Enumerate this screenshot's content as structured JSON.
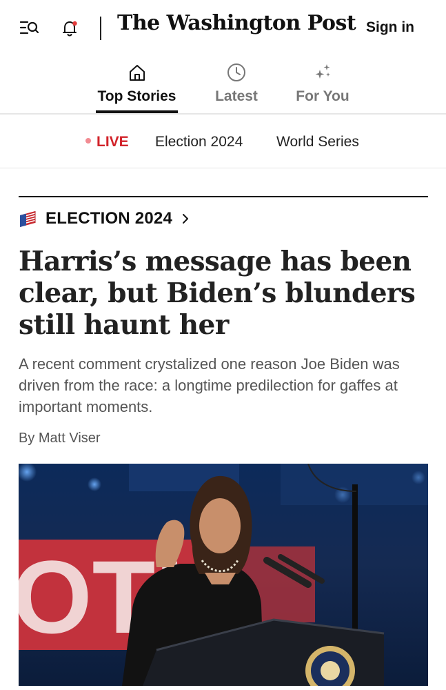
{
  "header": {
    "masthead": "The Washington Post",
    "sign_in_label": "Sign in",
    "icons": [
      "menu-search-icon",
      "bell-icon"
    ]
  },
  "tabs": [
    {
      "label": "Top Stories",
      "icon": "home-icon",
      "active": true
    },
    {
      "label": "Latest",
      "icon": "clock-icon",
      "active": false
    },
    {
      "label": "For You",
      "icon": "sparkle-icon",
      "active": false
    }
  ],
  "topics": {
    "live_label": "LIVE",
    "items": [
      "Election 2024",
      "World Series"
    ]
  },
  "article": {
    "kicker": "ELECTION 2024",
    "headline": "Harris’s message has been clear, but Biden’s blunders still haunt her",
    "dek": "A recent comment crystalized one reason Joe Biden was driven from the race: a longtime predilection for gaffes at important moments.",
    "byline": "By Matt Viser"
  },
  "colors": {
    "live_red": "#d2232a",
    "live_dot": "#f28b92",
    "text_primary": "#111111",
    "text_muted": "#777777"
  }
}
